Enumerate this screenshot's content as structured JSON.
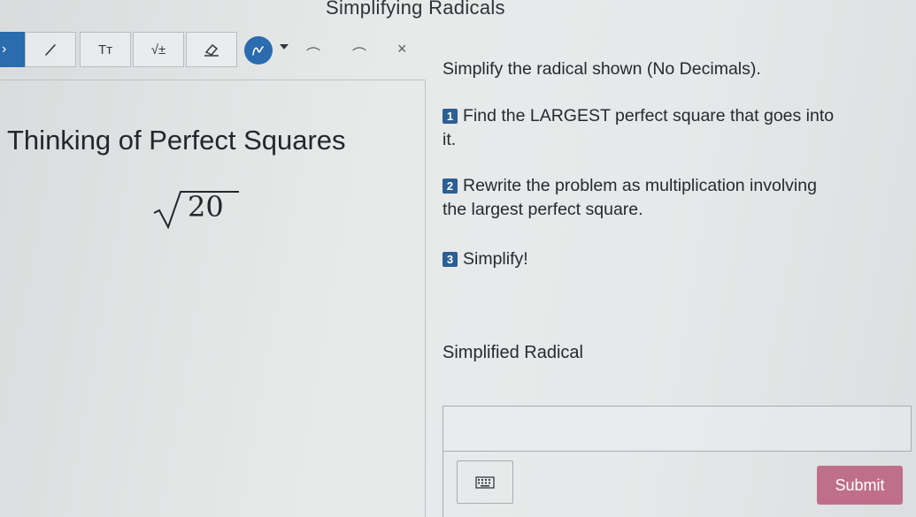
{
  "page": {
    "title": "Simplifying Radicals"
  },
  "toolbar": {
    "text_tool_label": "Tт",
    "math_tool_label": "√±",
    "items": [
      "pen-icon",
      "text-icon",
      "math-icon",
      "eraser-icon",
      "draw-icon",
      "undo-icon",
      "redo-icon",
      "close-icon"
    ],
    "accent_color": "#2a6cae"
  },
  "left": {
    "heading": "Thinking of Perfect Squares",
    "radicand": "20"
  },
  "right": {
    "instruction": "Simplify the radical shown (No Decimals).",
    "steps": [
      {
        "num": "1",
        "line1": "Find the LARGEST perfect square that goes into",
        "line2": "it."
      },
      {
        "num": "2",
        "line1": "Rewrite the problem as multiplication involving",
        "line2": "the largest perfect square."
      },
      {
        "num": "3",
        "line1": "Simplify!"
      }
    ],
    "answer_label": "Simplified Radical",
    "answer_value": "",
    "submit_label": "Submit",
    "submit_color": "#bf6f8a"
  }
}
